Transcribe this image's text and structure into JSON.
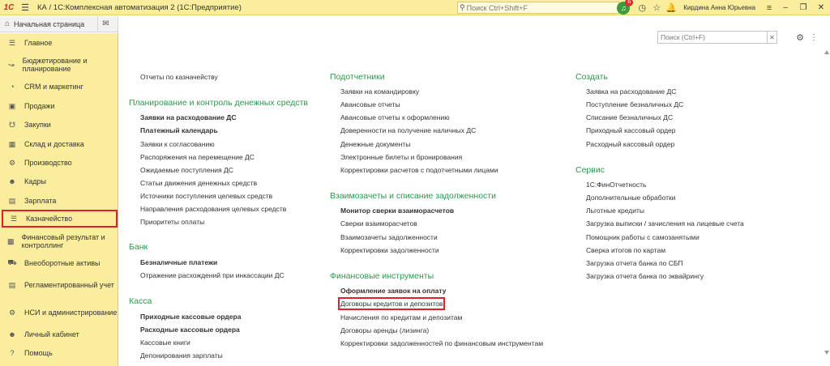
{
  "titlebar": {
    "logo": "1С",
    "title": "КА / 1С:Комплексная автоматизация 2  (1С:Предприятие)",
    "search_placeholder": "Поиск Ctrl+Shift+F",
    "notification_count": "6",
    "user": "Кирдина Анна Юрьевна"
  },
  "homebar": {
    "home_label": "Начальная страница"
  },
  "sidebar": {
    "items": [
      {
        "label": "Главное",
        "icon": "list-icon"
      },
      {
        "label": "Бюджетирование и планирование",
        "icon": "chart-icon"
      },
      {
        "label": "CRM и маркетинг",
        "icon": "pie-icon"
      },
      {
        "label": "Продажи",
        "icon": "bag-icon"
      },
      {
        "label": "Закупки",
        "icon": "cart-icon"
      },
      {
        "label": "Склад и доставка",
        "icon": "warehouse-icon"
      },
      {
        "label": "Производство",
        "icon": "factory-icon"
      },
      {
        "label": "Кадры",
        "icon": "people-icon"
      },
      {
        "label": "Зарплата",
        "icon": "wallet-icon"
      },
      {
        "label": "Казначейство",
        "icon": "coins-icon"
      },
      {
        "label": "Финансовый результат и контроллинг",
        "icon": "finance-icon"
      },
      {
        "label": "Внеоборотные активы",
        "icon": "car-icon"
      },
      {
        "label": "Регламентированный учет",
        "icon": "report-icon"
      },
      {
        "label": "НСИ и администрирование",
        "icon": "gear-icon"
      },
      {
        "label": "Личный кабинет",
        "icon": "user-icon"
      },
      {
        "label": "Помощь",
        "icon": "help-icon"
      }
    ]
  },
  "main": {
    "search_placeholder": "Поиск (Ctrl+F)",
    "col1": {
      "top_link": "Отчеты по казначейству",
      "sections": [
        {
          "title": "Планирование и контроль денежных средств",
          "links": [
            {
              "label": "Заявки на расходование ДС",
              "bold": true
            },
            {
              "label": "Платежный календарь",
              "bold": true
            },
            {
              "label": "Заявки к согласованию"
            },
            {
              "label": "Распоряжения на перемещение ДС"
            },
            {
              "label": "Ожидаемые поступления ДС"
            },
            {
              "label": "Статьи движения денежных средств"
            },
            {
              "label": "Источники поступления целевых средств"
            },
            {
              "label": "Направления расходования целевых средств"
            },
            {
              "label": "Приоритеты оплаты"
            }
          ]
        },
        {
          "title": "Банк",
          "links": [
            {
              "label": "Безналичные платежи",
              "bold": true
            },
            {
              "label": "Отражение расхождений при инкассации ДС"
            }
          ]
        },
        {
          "title": "Касса",
          "links": [
            {
              "label": "Приходные кассовые ордера",
              "bold": true
            },
            {
              "label": "Расходные кассовые ордера",
              "bold": true
            },
            {
              "label": "Кассовые книги"
            },
            {
              "label": "Депонирования зарплаты"
            }
          ]
        }
      ]
    },
    "col2": {
      "sections": [
        {
          "title": "Подотчетники",
          "links": [
            {
              "label": "Заявки на командировку"
            },
            {
              "label": "Авансовые отчеты"
            },
            {
              "label": "Авансовые отчеты к оформлению"
            },
            {
              "label": "Доверенности на получение наличных ДС"
            },
            {
              "label": "Денежные документы"
            },
            {
              "label": "Электронные билеты и бронирования"
            },
            {
              "label": "Корректировки расчетов с подотчетными лицами"
            }
          ]
        },
        {
          "title": "Взаимозачеты и списание задолженности",
          "links": [
            {
              "label": "Монитор сверки взаиморасчетов",
              "bold": true
            },
            {
              "label": "Сверки взаиморасчетов"
            },
            {
              "label": "Взаимозачеты задолженности"
            },
            {
              "label": "Корректировки задолженности"
            }
          ]
        },
        {
          "title": "Финансовые инструменты",
          "links": [
            {
              "label": "Оформление заявок на оплату",
              "bold": true
            },
            {
              "label": "Договоры кредитов и депозитов"
            },
            {
              "label": "Начисления по кредитам и депозитам"
            },
            {
              "label": "Договоры аренды (лизинга)"
            },
            {
              "label": "Корректировки задолженностей по финансовым инструментам"
            }
          ]
        }
      ]
    },
    "col3": {
      "sections": [
        {
          "title": "Создать",
          "links": [
            {
              "label": "Заявка на расходование ДС"
            },
            {
              "label": "Поступление безналичных ДС"
            },
            {
              "label": "Списание безналичных ДС"
            },
            {
              "label": "Приходный кассовый ордер"
            },
            {
              "label": "Расходный кассовый ордер"
            }
          ]
        },
        {
          "title": "Сервис",
          "links": [
            {
              "label": "1С:ФинОтчетность"
            },
            {
              "label": "Дополнительные обработки"
            },
            {
              "label": "Льготные кредиты"
            },
            {
              "label": "Загрузка выписки / зачисления на лицевые счета"
            },
            {
              "label": "Помощник работы с самозанятыми"
            },
            {
              "label": "Сверка итогов по картам"
            },
            {
              "label": "Загрузка отчета банка по СБП"
            },
            {
              "label": "Загрузка отчета банка по эквайрингу"
            }
          ]
        }
      ]
    }
  }
}
